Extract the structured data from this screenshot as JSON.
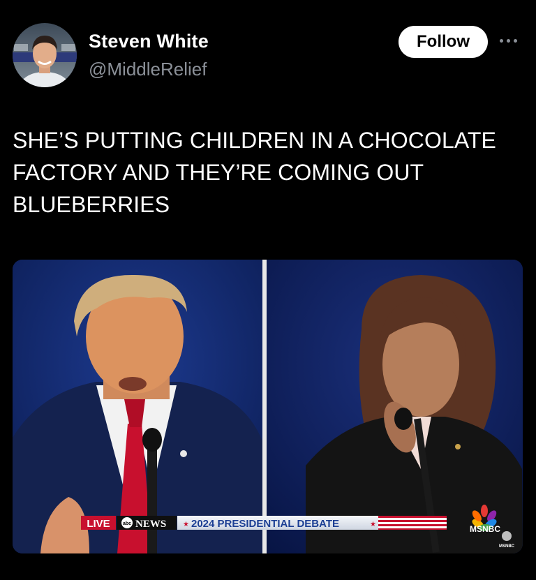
{
  "author": {
    "name": "Steven White",
    "handle": "@MiddleRelief"
  },
  "actions": {
    "follow_label": "Follow",
    "more_icon": "more-horizontal-icon"
  },
  "tweet": {
    "lines": [
      "SHE’S PUTTING CHILDREN IN A CHOCOLATE",
      "FACTORY AND THEY’RE COMING OUT",
      "BLUEBERRIES"
    ]
  },
  "media": {
    "live_label": "LIVE",
    "network_label": "NEWS",
    "banner_text": "2024 PRESIDENTIAL DEBATE",
    "msnbc_label": "MSNBC",
    "msnbc_small": "MSNBC"
  },
  "colors": {
    "background": "#000000",
    "secondary_text": "#8b9098",
    "follow_bg": "#ffffff",
    "live_red": "#c8102e",
    "banner_blue": "#1c3f94"
  }
}
